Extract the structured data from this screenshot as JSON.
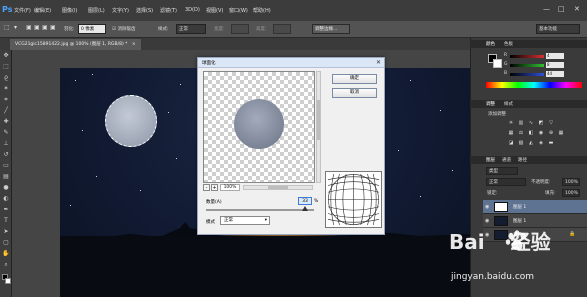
{
  "app": {
    "logo": "Ps"
  },
  "menubar": {
    "items": [
      "文件(F)",
      "编辑(E)",
      "图像(I)",
      "图层(L)",
      "文字(Y)",
      "选择(S)",
      "滤镜(T)",
      "3D(D)",
      "视图(V)",
      "窗口(W)",
      "帮助(H)"
    ]
  },
  "window_controls": {
    "minimize": "—",
    "maximize": "□",
    "close": "✕"
  },
  "options": {
    "feather_label": "羽化:",
    "feather_value": "0 像素",
    "antialias_label": "消除锯齿",
    "style_label": "样式:",
    "style_value": "正常",
    "width_label": "宽度:",
    "height_label": "高度:",
    "refine_button": "调整边缘...",
    "workspace_value": "基本功能"
  },
  "document": {
    "tab_label": "VCG21gic15891422.jpg @ 100% (图层 1, RGB/8) *",
    "tab_close": "×"
  },
  "dialog": {
    "title": "球面化",
    "ok_label": "确定",
    "cancel_label": "取消",
    "zoom_value": "100%",
    "zoom_minus": "-",
    "zoom_plus": "+",
    "amount_label": "数量(A)",
    "amount_value": "33",
    "amount_unit": "%",
    "mode_label": "模式",
    "mode_value": "正常",
    "close_icon": "✕"
  },
  "panels": {
    "color_tabs": [
      "颜色",
      "色板"
    ],
    "channels": [
      {
        "label": "R",
        "value": "4",
        "color": "#d93030"
      },
      {
        "label": "G",
        "value": "8",
        "color": "#30c030"
      },
      {
        "label": "B",
        "value": "44",
        "color": "#3050d8"
      }
    ],
    "adjust_tabs": [
      "调整",
      "样式"
    ],
    "adjust_title": "添加调整",
    "layer_tabs": [
      "图层",
      "通道",
      "路径"
    ],
    "blend_mode": "正常",
    "opacity_label": "不透明度:",
    "opacity_value": "100%",
    "lock_label": "锁定:",
    "fill_label": "填充:",
    "fill_value": "100%",
    "kind_label": "类型",
    "layers": [
      {
        "name": "图层 1",
        "selected": true
      },
      {
        "name": "图层 1",
        "selected": false
      },
      {
        "name": "背景",
        "selected": false
      }
    ]
  },
  "watermark": {
    "brand": "Bai",
    "brand2": "经验",
    "url": "jingyan.baidu.com"
  },
  "colors": {
    "accent": "#4aa3ff",
    "selection": "#5e7392"
  }
}
